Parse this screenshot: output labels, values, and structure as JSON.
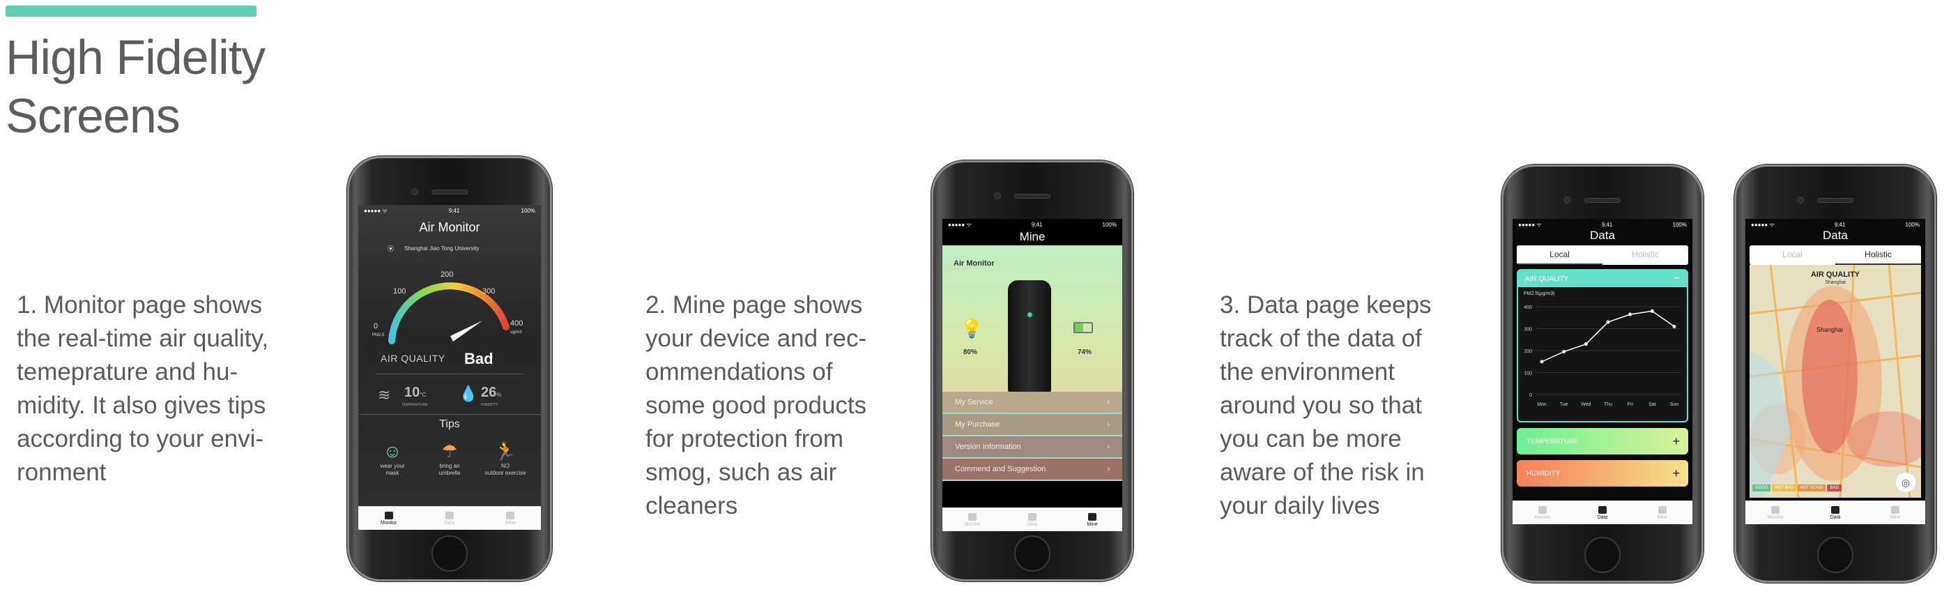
{
  "header": {
    "title": "High Fidelity\nScreens",
    "accent_color": "#5fcdb2"
  },
  "descriptions": [
    "1. Monitor page shows\nthe real-time air quality,\ntemeprature and hu-\nmidity. It also gives tips\naccording to your envi-\nronment",
    "2. Mine page shows\nyour device and rec-\nommendations of\nsome good products\nfor protection from\nsmog, such as air\ncleaners",
    "3. Data page keeps\ntrack of the data of\nthe environment\naround you so that\nyou can be more\naware of the risk in\nyour daily lives"
  ],
  "status_bar": {
    "carrier": "●●●●● ᯤ",
    "time": "9:41",
    "battery": "100%"
  },
  "monitor": {
    "title": "Air Monitor",
    "location": "Shanghai Jiao Tong University",
    "gauge_ticks": [
      "0",
      "100",
      "200",
      "300",
      "400"
    ],
    "gauge_small_left": "PM2.5",
    "gauge_small_right": "ug/m3",
    "aq_label": "AIR QUALITY",
    "aq_value": "Bad",
    "temperature": "10",
    "temperature_unit": "°C",
    "temperature_label": "TEMPERATURE",
    "humidity": "26",
    "humidity_unit": "%",
    "humidity_label": "HUMIDITY",
    "tips_title": "Tips",
    "tips": [
      {
        "text": "wear your\nmask",
        "icon": "mask-icon",
        "color": "#6fe0c2"
      },
      {
        "text": "bring an\numbrella",
        "icon": "umbrella-icon",
        "color": "#f0a050"
      },
      {
        "text": "NO\noutdoor exercise",
        "icon": "runner-icon",
        "color": "#ffffff"
      }
    ]
  },
  "mine": {
    "title": "Mine",
    "device_label": "Air Monitor",
    "left_stat": "80%",
    "right_stat": "74%",
    "menu": [
      "My Service",
      "My Purchase",
      "Version Information",
      "Commend and Suggestion"
    ]
  },
  "data_local": {
    "title": "Data",
    "segments": [
      "Local",
      "Holistic"
    ],
    "card_air": "AIR QUALITY",
    "chart_unit": "PM2.5(μg/m3)",
    "card_temp": "TEMPERATURE",
    "card_hum": "HUMIDITY"
  },
  "data_holistic": {
    "title": "Data",
    "segments": [
      "Local",
      "Holistic"
    ],
    "map_title": "AIR QUALITY",
    "map_city": "Shanghai",
    "map_place": "Shanghai",
    "legend": [
      "GOOD",
      "NOT BAD",
      "NOT GOOD",
      "BAD"
    ]
  },
  "tabs": [
    "Monitor",
    "Data",
    "Mine"
  ],
  "chart_data": {
    "type": "line",
    "categories": [
      "Mon",
      "Tue",
      "Wed",
      "Thu",
      "Fri",
      "Sat",
      "Sun"
    ],
    "values": [
      150,
      195,
      230,
      330,
      365,
      380,
      310
    ],
    "ylabel": "PM2.5(μg/m3)",
    "ylim": [
      0,
      400
    ],
    "yticks": [
      "400",
      "300",
      "200",
      "100",
      "0"
    ]
  }
}
